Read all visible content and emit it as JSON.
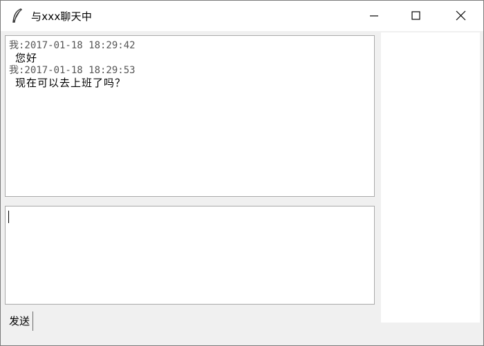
{
  "window": {
    "title": "与xxx聊天中",
    "app_icon": "feather-icon",
    "controls": {
      "minimize_icon": "minimize-icon",
      "maximize_icon": "maximize-icon",
      "close_icon": "close-icon"
    }
  },
  "history": {
    "messages": [
      {
        "sender": "我",
        "timestamp": "2017-01-18 18:29:42",
        "meta": "我:2017-01-18 18:29:42",
        "text": "您好"
      },
      {
        "sender": "我",
        "timestamp": "2017-01-18 18:29:53",
        "meta": "我:2017-01-18 18:29:53",
        "text": "现在可以去上班了吗？"
      }
    ]
  },
  "input": {
    "value": ""
  },
  "send_button": {
    "label": "发送"
  }
}
